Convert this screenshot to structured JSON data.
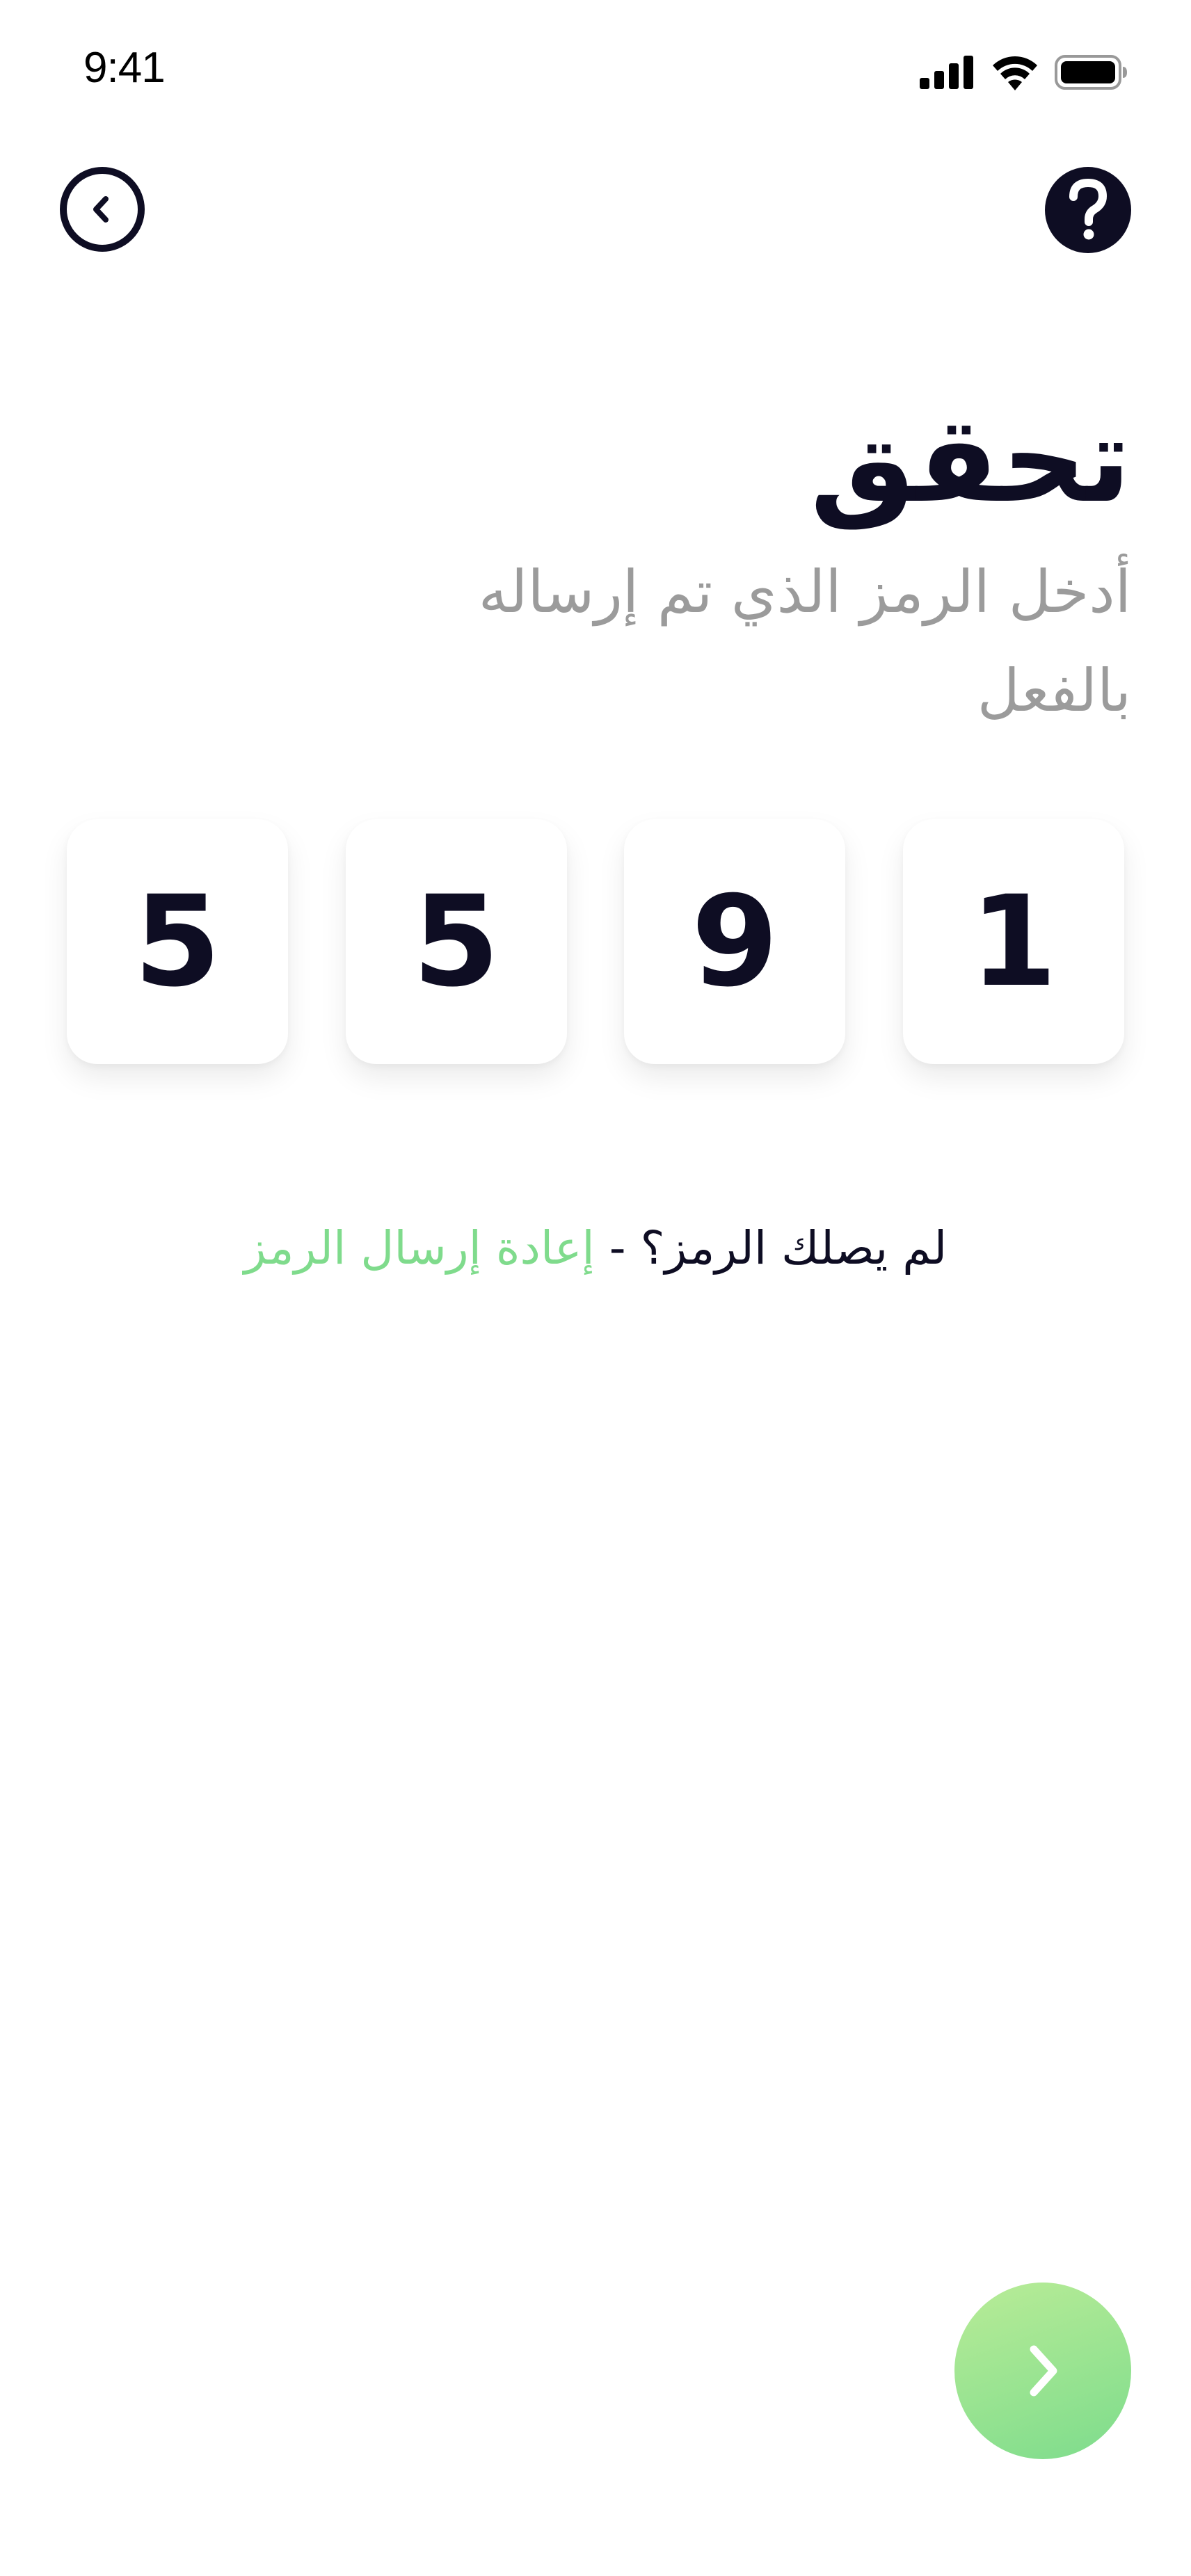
{
  "status_bar": {
    "time": "9:41",
    "icons": [
      "cellular-signal-icon",
      "wifi-icon",
      "battery-icon"
    ]
  },
  "header": {
    "back_icon": "chevron-left-circle-icon",
    "help_icon": "question-circle-icon"
  },
  "title": "تحقق",
  "subtitle": "أدخل الرمز الذي تم إرساله بالفعل",
  "otp": {
    "digits": [
      "5",
      "5",
      "9",
      "1"
    ]
  },
  "resend": {
    "prompt": "لم يصلك الرمز؟",
    "separator": " - ",
    "link_label": "إعادة إرسال الرمز"
  },
  "next_button": {
    "icon": "chevron-right-icon"
  },
  "colors": {
    "primary_text": "#0e0d23",
    "muted_text": "#9b9b9b",
    "accent_green": "#7fdb8c",
    "accent_green_light": "#b9ec97"
  }
}
